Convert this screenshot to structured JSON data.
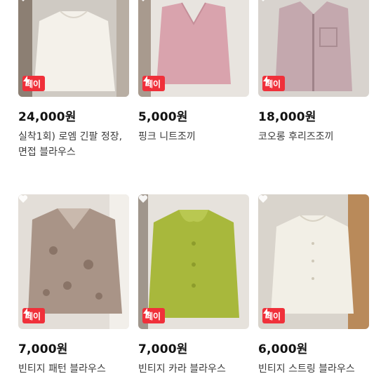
{
  "badge_label": "페이",
  "items": [
    {
      "price": "24,000원",
      "title": "실착1회) 로엠 긴팔 정장, 면접 블라우스",
      "badge_icon": "lightning-bolt-icon",
      "item_color": "#f4f1ea"
    },
    {
      "price": "5,000원",
      "title": "핑크 니트조끼",
      "badge_icon": "lightning-bolt-icon",
      "item_color": "#d9a3ad"
    },
    {
      "price": "18,000원",
      "title": "코오롱 후리즈조끼",
      "badge_icon": "lightning-bolt-icon",
      "item_color": "#c4a8ae"
    },
    {
      "price": "7,000원",
      "title": "빈티지 패턴 블라우스",
      "badge_icon": "lightning-bolt-icon",
      "item_color": "#a99487"
    },
    {
      "price": "7,000원",
      "title": "빈티지 카라 블라우스",
      "badge_icon": "lightning-bolt-icon",
      "item_color": "#a8b83c"
    },
    {
      "price": "6,000원",
      "title": "빈티지 스트링 블라우스",
      "badge_icon": "lightning-bolt-icon",
      "item_color": "#f2efe6"
    }
  ],
  "colors": {
    "badge_bg": "#f0303a",
    "price_text": "#111111",
    "title_text": "#3a3a3a"
  }
}
